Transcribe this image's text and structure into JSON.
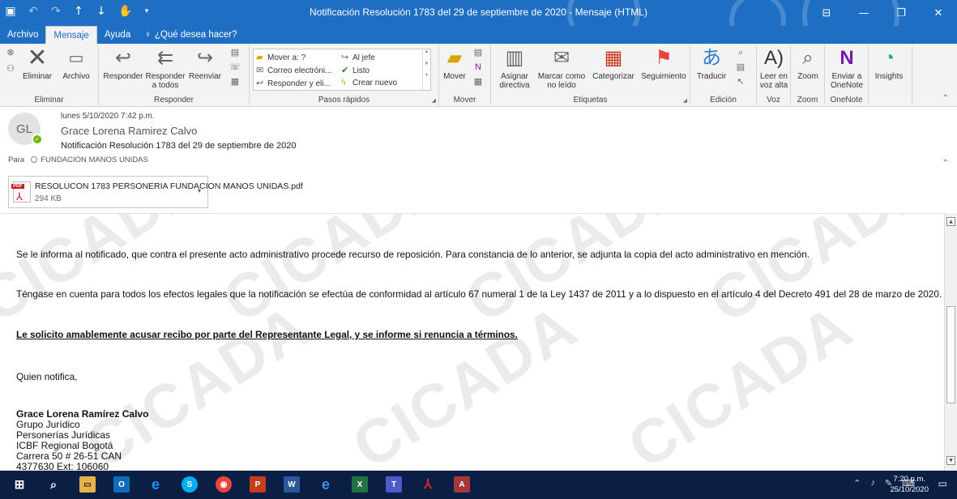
{
  "window": {
    "title": "Notificación Resolución 1783 del 29 de septiembre de 2020  -  Mensaje (HTML)"
  },
  "tabs": [
    {
      "label": "Archivo"
    },
    {
      "label": "Mensaje"
    },
    {
      "label": "Ayuda"
    }
  ],
  "tell_me": "¿Qué desea hacer?",
  "ribbon": {
    "eliminar": {
      "label": "Eliminar",
      "eliminar_btn": "Eliminar",
      "archivo_btn": "Archivo"
    },
    "responder": {
      "label": "Responder",
      "responder_btn": "Responder",
      "responder_todos_1": "Responder",
      "responder_todos_2": "a todos",
      "reenviar_btn": "Reenviar"
    },
    "pasos": {
      "label": "Pasos rápidos",
      "items": [
        "Mover a: ?",
        "Correo electróni...",
        "Responder y eli...",
        "Al jefe",
        "Listo",
        "Crear nuevo"
      ]
    },
    "mover": {
      "label": "Mover",
      "mover_btn": "Mover"
    },
    "etiquetas": {
      "label": "Etiquetas",
      "asignar_1": "Asignar",
      "asignar_2": "directiva",
      "marcar_1": "Marcar como",
      "marcar_2": "no leído",
      "categorizar": "Categorizar",
      "seguimiento": "Seguimiento"
    },
    "edicion": {
      "label": "Edición",
      "traducir": "Traducir"
    },
    "voz": {
      "label": "Voz",
      "leer_1": "Leer en",
      "leer_2": "voz alta"
    },
    "zoom": {
      "label": "Zoom",
      "zoom_btn": "Zoom"
    },
    "onenote": {
      "label": "OneNote",
      "enviar_1": "Enviar a",
      "enviar_2": "OneNote"
    },
    "insights": {
      "label": "Insights"
    }
  },
  "header": {
    "avatar_initials": "GL",
    "date": "lunes 5/10/2020 7:42 p.m.",
    "sender": "Grace Lorena Ramirez Calvo",
    "subject": "Notificación Resolución 1783 del 29 de septiembre de 2020",
    "to_label": "Para",
    "to_value": "FUNDACION MANOS UNIDAS"
  },
  "attachment": {
    "name": "RESOLUCON 1783 PERSONERIA FUNDACION MANOS UNIDAS.pdf",
    "size": "294 KB",
    "tag": "PDF"
  },
  "body": {
    "p1": "Se le informa al notificado, que contra el presente acto administrativo procede recurso de reposición. Para constancia de lo anterior, se adjunta la copia del acto administrativo en mención.",
    "p2": "Téngase en cuenta para todos los efectos legales que la notificación se efectúa de conformidad al artículo 67 numeral 1 de la Ley 1437 de 2011 y a lo dispuesto en el artículo 4 del Decreto 491 del 28 de marzo de 2020.",
    "p3": "Le solicito amablemente acusar recibo por parte del Representante Legal, y se informe si renuncia a términos.",
    "p4": "Quien notifica,",
    "sig_name": "Grace Lorena Ramírez Calvo",
    "sig_lines": [
      "Grupo Jurídico",
      "Personerías Jurídicas",
      "ICBF Regional Bogotá",
      "Carrera 50 # 26-51 CAN",
      "4377630 Ext: 106060"
    ]
  },
  "taskbar": {
    "clock_time": "7:20 p.m.",
    "clock_date": "25/10/2020"
  },
  "colors": {
    "accent": "#1e6fc4",
    "taskbar": "#0b1f44",
    "flag": "#e0473a",
    "presence": "#6bb700",
    "pdf_red": "#c41b1b"
  }
}
